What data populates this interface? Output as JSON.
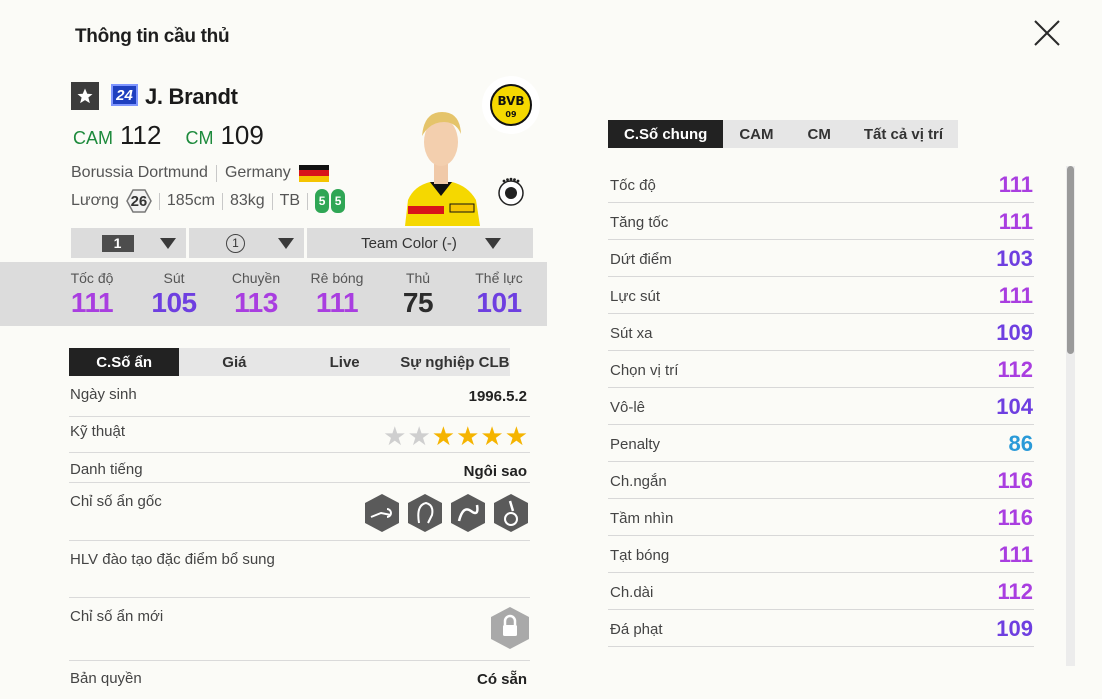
{
  "title": "Thông tin cầu thủ",
  "player": {
    "season_badge": "24",
    "name": "J. Brandt",
    "positions": [
      {
        "pos": "CAM",
        "ovr": "112"
      },
      {
        "pos": "CM",
        "ovr": "109"
      }
    ],
    "club": "Borussia Dortmund",
    "nation": "Germany",
    "salary_label": "Lương",
    "salary": "26",
    "height": "185cm",
    "weight": "83kg",
    "body": "TB",
    "left_foot": "5",
    "right_foot": "5",
    "club_logo_text": "BVB",
    "club_logo_sub": "09"
  },
  "dropdowns": {
    "level": "1",
    "upgrade": "1",
    "team_color": "Team Color (-)"
  },
  "summary_stats": [
    {
      "label": "Tốc độ",
      "value": "111",
      "color": "#a93ee0"
    },
    {
      "label": "Sút",
      "value": "105",
      "color": "#6e3fe0"
    },
    {
      "label": "Chuyền",
      "value": "113",
      "color": "#a93ee0"
    },
    {
      "label": "Rê bóng",
      "value": "111",
      "color": "#a93ee0"
    },
    {
      "label": "Thủ",
      "value": "75",
      "color": "#2c2c2c"
    },
    {
      "label": "Thể lực",
      "value": "101",
      "color": "#6e3fe0"
    }
  ],
  "left_tabs": [
    "C.Số ẩn",
    "Giá",
    "Live",
    "Sự nghiệp CLB"
  ],
  "info": {
    "birth_label": "Ngày sinh",
    "birth": "1996.5.2",
    "skill_label": "Kỹ thuật",
    "skill_stars": 4,
    "skill_total": 6,
    "fame_label": "Danh tiếng",
    "fame": "Ngôi sao",
    "traits_label": "Chỉ số ẩn gốc",
    "traits": [
      "long-shot-trait-icon",
      "playmaker-trait-icon",
      "dribbler-trait-icon",
      "finesse-trait-icon"
    ],
    "coach_label": "HLV đào tạo đặc điểm bổ sung",
    "new_traits_label": "Chỉ số ẩn mới",
    "license_label": "Bản quyền",
    "license": "Có sẵn"
  },
  "right_tabs": [
    "C.Số chung",
    "CAM",
    "CM",
    "Tất cả vị trí"
  ],
  "attributes": [
    {
      "label": "Tốc độ",
      "value": "111",
      "color": "#a93ee0"
    },
    {
      "label": "Tăng tốc",
      "value": "111",
      "color": "#a93ee0"
    },
    {
      "label": "Dứt điểm",
      "value": "103",
      "color": "#6e3fe0"
    },
    {
      "label": "Lực sút",
      "value": "111",
      "color": "#a93ee0"
    },
    {
      "label": "Sút xa",
      "value": "109",
      "color": "#6e3fe0"
    },
    {
      "label": "Chọn vị trí",
      "value": "112",
      "color": "#a93ee0"
    },
    {
      "label": "Vô-lê",
      "value": "104",
      "color": "#6e3fe0"
    },
    {
      "label": "Penalty",
      "value": "86",
      "color": "#2a9ad8"
    },
    {
      "label": "Ch.ngắn",
      "value": "116",
      "color": "#a93ee0"
    },
    {
      "label": "Tầm nhìn",
      "value": "116",
      "color": "#a93ee0"
    },
    {
      "label": "Tạt bóng",
      "value": "111",
      "color": "#a93ee0"
    },
    {
      "label": "Ch.dài",
      "value": "112",
      "color": "#a93ee0"
    },
    {
      "label": "Đá phạt",
      "value": "109",
      "color": "#6e3fe0"
    }
  ]
}
